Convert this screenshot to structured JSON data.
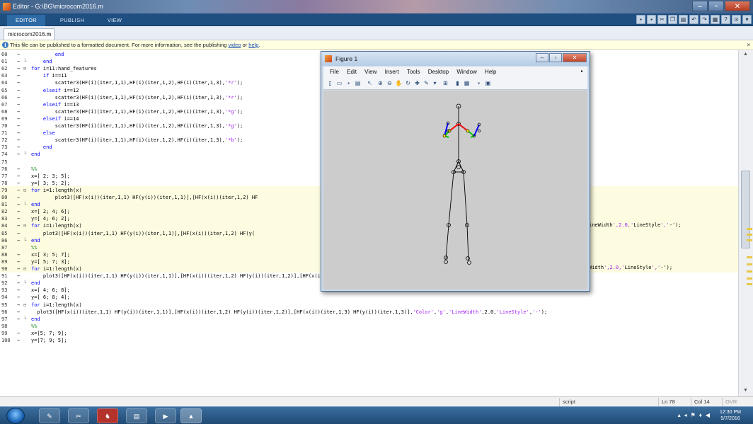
{
  "window": {
    "title": "Editor - G:\\BG\\microcom2016.m"
  },
  "ribbon": {
    "tabs": [
      {
        "label": "EDITOR"
      },
      {
        "label": "PUBLISH"
      },
      {
        "label": "VIEW"
      }
    ],
    "active": "EDITOR"
  },
  "document": {
    "tab_label": "microcom2016.m",
    "close_label": "×"
  },
  "infobar": {
    "text": "This file can be published to a formatted document. For more information, see the publishing ",
    "link_video": "video",
    "middle": " or ",
    "link_help": "help",
    "end": ".",
    "close": "×"
  },
  "editor": {
    "lines": [
      {
        "n": "60",
        "fold": "",
        "code": "        end"
      },
      {
        "n": "61",
        "fold": "└",
        "code": "    end"
      },
      {
        "n": "62",
        "fold": "⊟",
        "code": "for i=11:hand_features"
      },
      {
        "n": "63",
        "fold": "",
        "code": "    if i==11"
      },
      {
        "n": "64",
        "fold": "",
        "code": "        scatter3(HF(i)(iter,1,1),HF(i)(iter,1,2),HF(i)(iter,1,3),'*r');"
      },
      {
        "n": "65",
        "fold": "",
        "code": "    elseif i==12"
      },
      {
        "n": "66",
        "fold": "",
        "code": "        scatter3(HF(i)(iter,1,1),HF(i)(iter,1,2),HF(i)(iter,1,3),'*r');"
      },
      {
        "n": "67",
        "fold": "",
        "code": "    elseif i==13"
      },
      {
        "n": "68",
        "fold": "",
        "code": "        scatter3(HF(i)(iter,1,1),HF(i)(iter,1,2),HF(i)(iter,1,3),'*g');"
      },
      {
        "n": "69",
        "fold": "",
        "code": "    elseif i==14"
      },
      {
        "n": "70",
        "fold": "",
        "code": "        scatter3(HF(i)(iter,1,1),HF(i)(iter,1,2),HF(i)(iter,1,3),'*g');"
      },
      {
        "n": "71",
        "fold": "",
        "code": "    else"
      },
      {
        "n": "72",
        "fold": "",
        "code": "        scatter3(HF(i)(iter,1,1),HF(i)(iter,1,2),HF(i)(iter,1,3),'*b');"
      },
      {
        "n": "73",
        "fold": "",
        "code": "    end"
      },
      {
        "n": "74",
        "fold": "└",
        "code": "end"
      },
      {
        "n": "75",
        "fold": "",
        "code": ""
      },
      {
        "n": "76",
        "fold": "",
        "code": "%%"
      },
      {
        "n": "77",
        "fold": "",
        "code": "x=[ 2; 3; 5];"
      },
      {
        "n": "78",
        "fold": "",
        "code": "y=[ 3; 5; 2];"
      },
      {
        "n": "79",
        "fold": "⊟",
        "code": "for i=1:length(x)"
      },
      {
        "n": "80",
        "fold": "",
        "code": "        plot3([HF(x(i))(iter,1,1) HF(y(i))(iter,1,1)],[HF(x(i))(iter,1,2) HF"
      },
      {
        "n": "81",
        "fold": "└",
        "code": "end"
      },
      {
        "n": "82",
        "fold": "",
        "code": "x=[ 2; 4; 6];"
      },
      {
        "n": "83",
        "fold": "",
        "code": "y=[ 4; 6; 2];"
      },
      {
        "n": "84",
        "fold": "⊟",
        "code": "for i=1:length(x)"
      },
      {
        "n": "85",
        "fold": "",
        "code": "    plot3([HF(x(i))(iter,1,1) HF(y(i))(iter,1,1)],[HF(x(i))(iter,1,2) HF(y("
      },
      {
        "n": "86",
        "fold": "└",
        "code": "end"
      },
      {
        "n": "87",
        "fold": "",
        "code": "%%"
      },
      {
        "n": "88",
        "fold": "",
        "code": "x=[ 3; 5; 7];"
      },
      {
        "n": "89",
        "fold": "",
        "code": "y=[ 5; 7; 3];"
      },
      {
        "n": "90",
        "fold": "⊟",
        "code": "for i=1:length(x)"
      },
      {
        "n": "91",
        "fold": "",
        "code": "    plot3([HF(x(i))(iter,1,1) HF(y(i))(iter,1,1)],[HF(x(i))(iter,1,2) HF(y(i))(iter,1,2)],[HF(x(i))(iter,1,3) HF(y(i))(iter,1,3)],'Color','g','LineWidth',2.0,'LineStyle','-');"
      },
      {
        "n": "92",
        "fold": "└",
        "code": "end"
      },
      {
        "n": "93",
        "fold": "",
        "code": "x=[ 4; 6; 8];"
      },
      {
        "n": "94",
        "fold": "",
        "code": "y=[ 6; 8; 4];"
      },
      {
        "n": "95",
        "fold": "⊟",
        "code": "for i=1:length(x)"
      },
      {
        "n": "96",
        "fold": "",
        "code": "  plot3([HF(x(i))(iter,1,1) HF(y(i))(iter,1,1)],[HF(x(i))(iter,1,2) HF(y(i))(iter,1,2)],[HF(x(i))(iter,1,3) HF(y(i))(iter,1,3)],'Color','g','LineWidth',2.0,'LineStyle','-');"
      },
      {
        "n": "97",
        "fold": "└",
        "code": "end"
      },
      {
        "n": "98",
        "fold": "",
        "code": "%%"
      },
      {
        "n": "99",
        "fold": "",
        "code": "x=[5; 7; 9];"
      },
      {
        "n": "100",
        "fold": "",
        "code": "y=[7; 9; 5];"
      }
    ],
    "overflow_tails": [
      {
        "text": "ineWidth',2.0,'LineStyle','-');"
      },
      {
        "text": "Width',2.0,'LineStyle','-');"
      }
    ]
  },
  "statusbar": {
    "mode": "script",
    "ln": "Ln  78",
    "col": "Col  14",
    "ovr": "OVR"
  },
  "taskbar": {
    "time": "12:30 PM",
    "date": "5/7/2016"
  },
  "figure": {
    "title": "Figure 1",
    "menu": [
      "File",
      "Edit",
      "View",
      "Insert",
      "Tools",
      "Desktop",
      "Window",
      "Help"
    ],
    "toolbar_icons": [
      "new-figure-icon",
      "open-file-icon",
      "save-icon",
      "print-icon",
      "pointer-icon",
      "zoom-in-icon",
      "zoom-out-icon",
      "pan-icon",
      "rotate-icon",
      "data-cursor-icon",
      "brush-icon",
      "link-icon",
      "colorbar-icon",
      "legend-icon",
      "hide-plot-tools-icon",
      "show-plot-tools-icon"
    ],
    "colors": {
      "red": "#ff0000",
      "green": "#00cc00",
      "blue": "#0000ff",
      "yellow": "#ffee00",
      "black": "#000000"
    }
  }
}
